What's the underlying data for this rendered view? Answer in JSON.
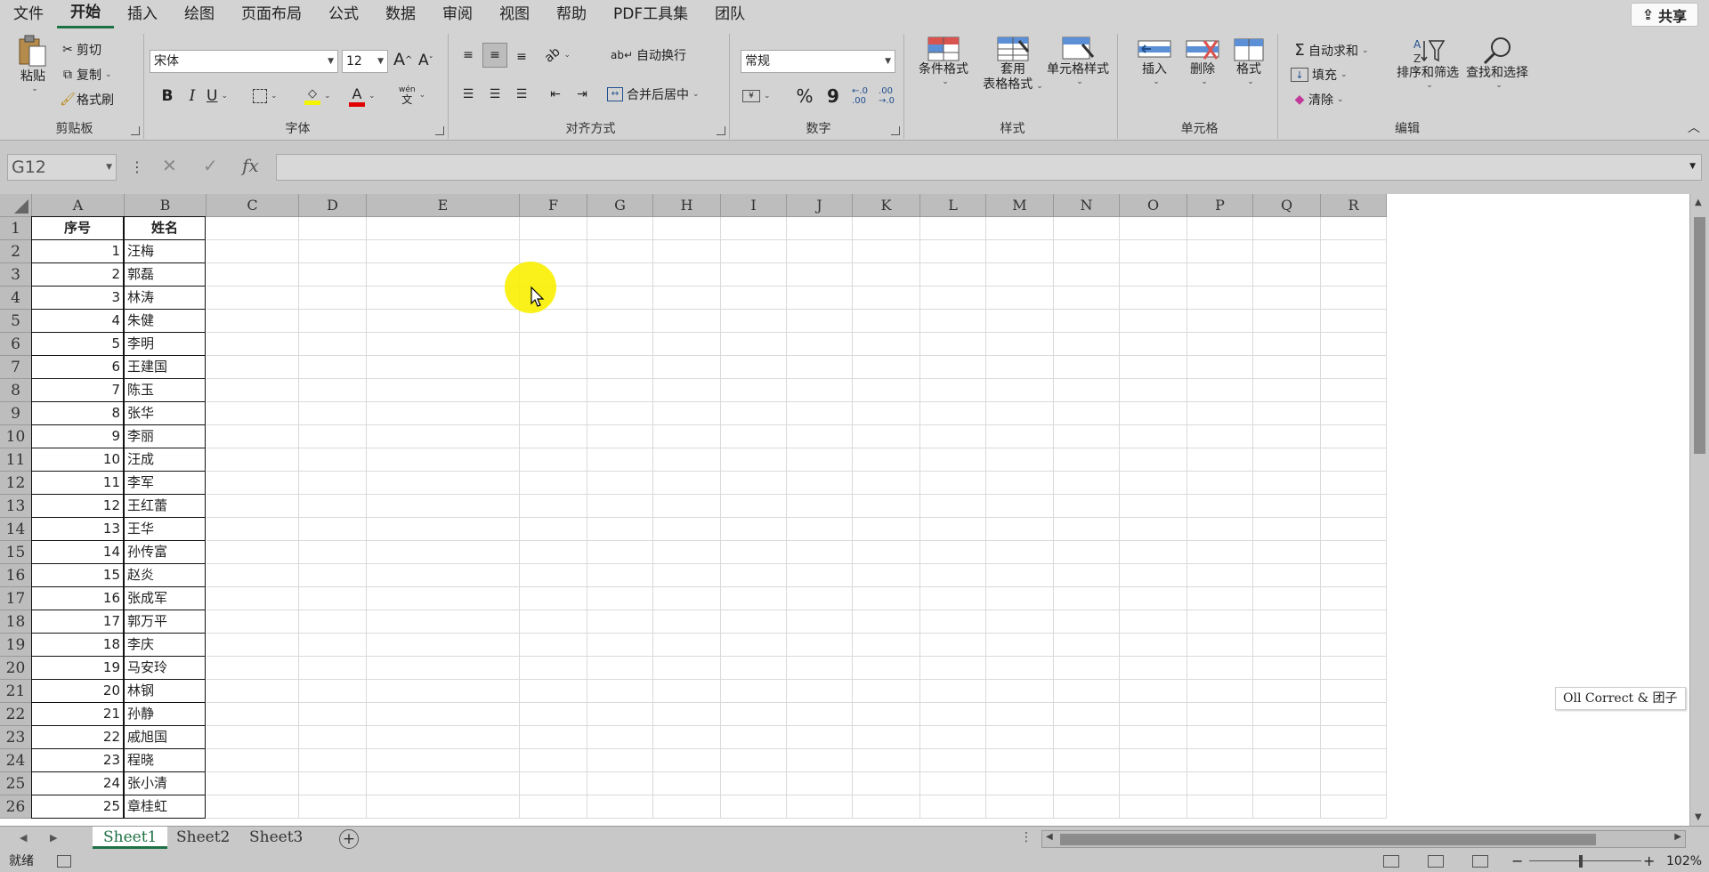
{
  "menu": {
    "tabs": [
      "文件",
      "开始",
      "插入",
      "绘图",
      "页面布局",
      "公式",
      "数据",
      "审阅",
      "视图",
      "帮助",
      "PDF工具集",
      "团队"
    ],
    "active_tab": "开始",
    "share_label": "共享"
  },
  "ribbon": {
    "clipboard": {
      "label": "剪贴板",
      "paste": "粘贴",
      "cut": "剪切",
      "copy": "复制",
      "format_painter": "格式刷"
    },
    "font": {
      "label": "字体",
      "font_name": "宋体",
      "font_size": "12",
      "bold": "B",
      "italic": "I",
      "underline": "U",
      "grow": "A",
      "shrink": "A",
      "font_color_letter": "A",
      "phonetic_top": "wén",
      "phonetic_bottom": "文"
    },
    "alignment": {
      "label": "对齐方式",
      "wrap_text": "自动换行",
      "merge_center": "合并后居中"
    },
    "number": {
      "label": "数字",
      "format": "常规",
      "percent": "%",
      "comma": "9"
    },
    "styles": {
      "label": "样式",
      "conditional": "条件格式",
      "table_format_line1": "套用",
      "table_format_line2": "表格格式",
      "cell_styles": "单元格样式"
    },
    "cells": {
      "label": "单元格",
      "insert": "插入",
      "delete": "删除",
      "format": "格式"
    },
    "editing": {
      "label": "编辑",
      "autosum": "自动求和",
      "fill": "填充",
      "clear": "清除",
      "sort_filter": "排序和筛选",
      "find_select": "查找和选择"
    }
  },
  "formula_bar": {
    "name_box": "G12",
    "formula": ""
  },
  "sheet": {
    "columns": [
      "A",
      "B",
      "C",
      "D",
      "E",
      "F",
      "G",
      "H",
      "I",
      "J",
      "K",
      "L",
      "M",
      "N",
      "O",
      "P",
      "Q",
      "R"
    ],
    "rows": [
      "1",
      "2",
      "3",
      "4",
      "5",
      "6",
      "7",
      "8",
      "9",
      "10",
      "11",
      "12",
      "13",
      "14",
      "15",
      "16",
      "17",
      "18",
      "19",
      "20",
      "21",
      "22",
      "23",
      "24",
      "25",
      "26"
    ],
    "header_a": "序号",
    "header_b": "姓名",
    "data": [
      [
        "1",
        "汪梅"
      ],
      [
        "2",
        "郭磊"
      ],
      [
        "3",
        "林涛"
      ],
      [
        "4",
        "朱健"
      ],
      [
        "5",
        "李明"
      ],
      [
        "6",
        "王建国"
      ],
      [
        "7",
        "陈玉"
      ],
      [
        "8",
        "张华"
      ],
      [
        "9",
        "李丽"
      ],
      [
        "10",
        "汪成"
      ],
      [
        "11",
        "李军"
      ],
      [
        "12",
        "王红蕾"
      ],
      [
        "13",
        "王华"
      ],
      [
        "14",
        "孙传富"
      ],
      [
        "15",
        "赵炎"
      ],
      [
        "16",
        "张成军"
      ],
      [
        "17",
        "郭万平"
      ],
      [
        "18",
        "李庆"
      ],
      [
        "19",
        "马安玲"
      ],
      [
        "20",
        "林钢"
      ],
      [
        "21",
        "孙静"
      ],
      [
        "22",
        "戚旭国"
      ],
      [
        "23",
        "程晓"
      ],
      [
        "24",
        "张小清"
      ],
      [
        "25",
        "章桂虹"
      ]
    ]
  },
  "watermark": "Oll Correct & 团子",
  "sheet_tabs": [
    "Sheet1",
    "Sheet2",
    "Sheet3"
  ],
  "active_sheet": "Sheet1",
  "add_sheet": "+",
  "status": {
    "text": "就绪",
    "zoom": "102%",
    "zoom_minus": "−",
    "zoom_plus": "+"
  }
}
